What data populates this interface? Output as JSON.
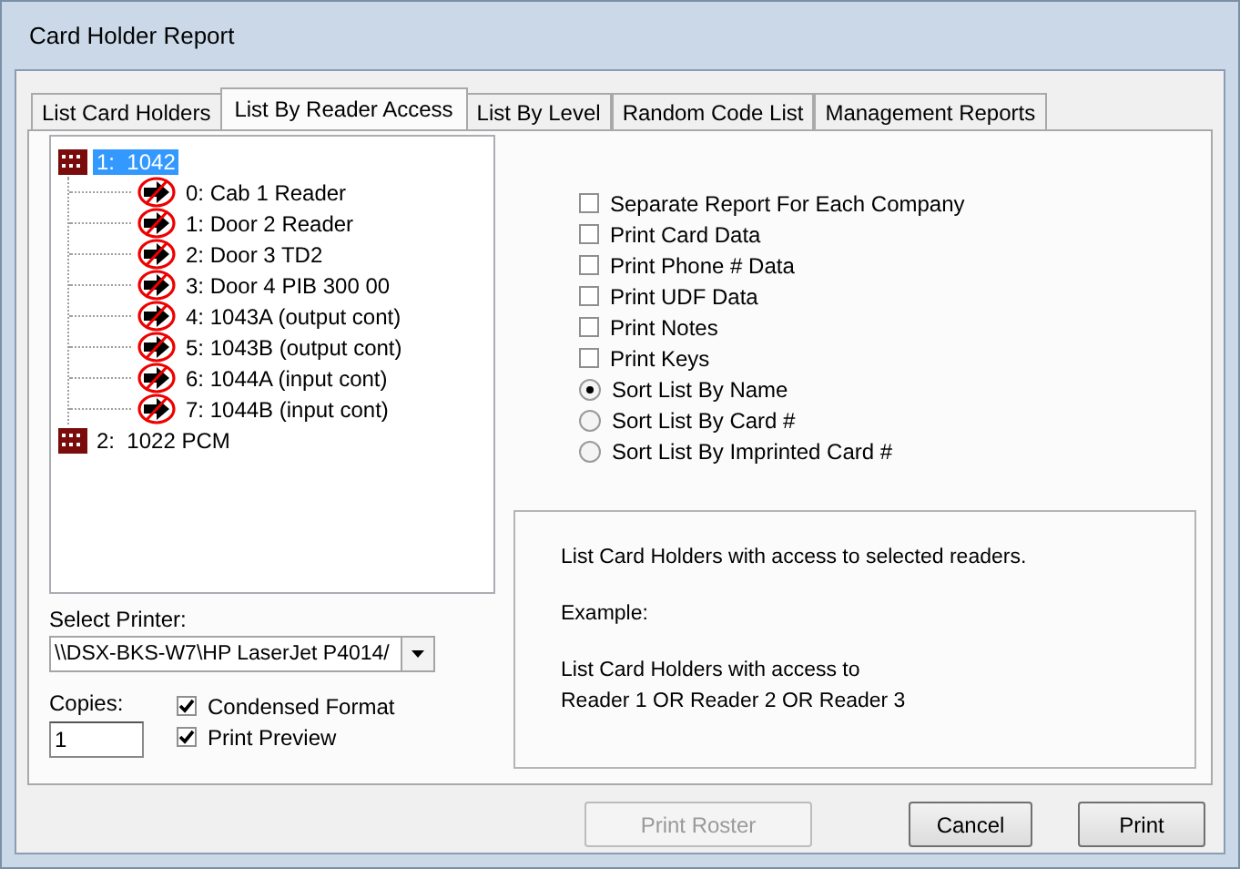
{
  "window": {
    "title": "Card Holder Report"
  },
  "tabs": [
    {
      "label": "List Card Holders",
      "selected": false
    },
    {
      "label": "List By Reader Access",
      "selected": true
    },
    {
      "label": "List By Level",
      "selected": false
    },
    {
      "label": "Random Code List",
      "selected": false
    },
    {
      "label": "Management Reports",
      "selected": false
    }
  ],
  "tree": [
    {
      "label": "1:  1042",
      "selected": true,
      "children": [
        {
          "label": "0: Cab 1 Reader",
          "selected": false
        },
        {
          "label": "1: Door 2 Reader",
          "selected": false
        },
        {
          "label": "2: Door 3 TD2",
          "selected": false
        },
        {
          "label": "3: Door 4 PIB 300 00",
          "selected": false
        },
        {
          "label": "4: 1043A (output cont)",
          "selected": false
        },
        {
          "label": "5: 1043B (output cont)",
          "selected": false
        },
        {
          "label": "6: 1044A (input cont)",
          "selected": false
        },
        {
          "label": "7: 1044B (input cont)",
          "selected": false
        }
      ]
    },
    {
      "label": "2:  1022 PCM",
      "selected": false
    }
  ],
  "options": [
    {
      "kind": "checkbox",
      "label": "Separate Report For Each Company",
      "checked": false
    },
    {
      "kind": "checkbox",
      "label": "Print Card Data",
      "checked": false
    },
    {
      "kind": "checkbox",
      "label": "Print Phone # Data",
      "checked": false
    },
    {
      "kind": "checkbox",
      "label": "Print UDF Data",
      "checked": false
    },
    {
      "kind": "checkbox",
      "label": "Print Notes",
      "checked": false
    },
    {
      "kind": "checkbox",
      "label": "Print Keys",
      "checked": false
    },
    {
      "kind": "radio",
      "label": "Sort List By Name",
      "selected": true
    },
    {
      "kind": "radio",
      "label": "Sort List By Card #",
      "selected": false
    },
    {
      "kind": "radio",
      "label": "Sort List By Imprinted Card #",
      "selected": false
    }
  ],
  "description": {
    "text": "List Card Holders with access to selected readers.",
    "example_label": "Example:",
    "example_lines": [
      "List Card Holders with access to",
      "Reader 1 OR Reader 2 OR Reader 3"
    ]
  },
  "printer": {
    "label": "Select Printer:",
    "value": "\\\\DSX-BKS-W7\\HP LaserJet P4014/"
  },
  "copies": {
    "label": "Copies:",
    "value": "1"
  },
  "print_flags": [
    {
      "label": "Condensed Format",
      "checked": true
    },
    {
      "label": "Print Preview",
      "checked": true
    }
  ],
  "buttons": [
    {
      "label": "Print Roster",
      "disabled": true
    },
    {
      "label": "Cancel",
      "disabled": false
    },
    {
      "label": "Print",
      "disabled": false
    }
  ]
}
